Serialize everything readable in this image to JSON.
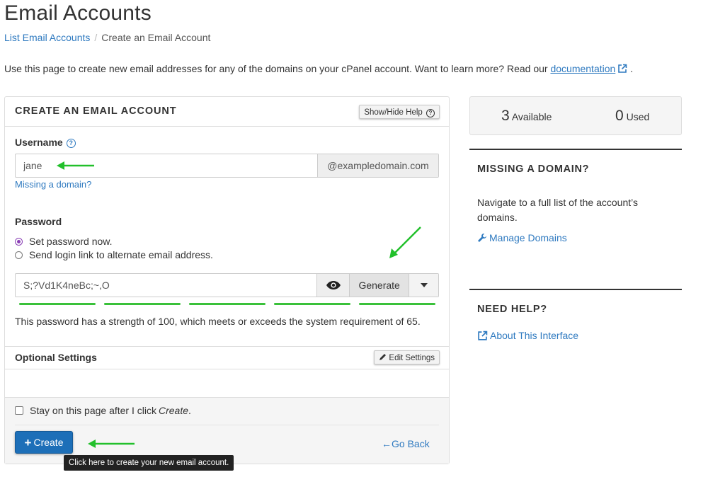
{
  "header": {
    "title": "Email Accounts",
    "breadcrumb_link": "List Email Accounts",
    "breadcrumb_current": "Create an Email Account",
    "intro_text": "Use this page to create new email addresses for any of the domains on your cPanel account. Want to learn more? Read our ",
    "intro_link": "documentation",
    "intro_end": "."
  },
  "form": {
    "panel_title": "CREATE AN EMAIL ACCOUNT",
    "help_toggle_label": "Show/Hide Help",
    "username_label": "Username",
    "username_value": "jane",
    "domain_addon": "@exampledomain.com",
    "missing_domain_link": "Missing a domain?",
    "password_label": "Password",
    "radio_set_now": "Set password now.",
    "radio_send_link": "Send login link to alternate email address.",
    "password_value": "S;?Vd1K4neBc;~,O",
    "generate_label": "Generate",
    "strength_percent": 100,
    "strength_text": "This password has a strength of 100, which meets or exceeds the system requirement of 65.",
    "optional_settings_label": "Optional Settings",
    "edit_settings_label": "Edit Settings",
    "stay_prefix": "Stay on this page after I click ",
    "stay_emph": "Create",
    "stay_suffix": ".",
    "create_label": "Create",
    "go_back_label": "Go Back",
    "create_tooltip": "Click here to create your new email account."
  },
  "sidebar": {
    "available_count": "3",
    "available_label": "Available",
    "used_count": "0",
    "used_label": "Used",
    "missing_domain_title": "MISSING A DOMAIN?",
    "missing_domain_text": "Navigate to a full list of the account’s domains.",
    "manage_domains_link": "Manage Domains",
    "need_help_title": "NEED HELP?",
    "about_link": "About This Interface"
  },
  "colors": {
    "link": "#2f7ac0",
    "primary_button": "#1d6fb8",
    "strength_meter": "#3ac13a",
    "annotation_arrow": "#22c02b",
    "radio_checked": "#8a3fb5"
  }
}
